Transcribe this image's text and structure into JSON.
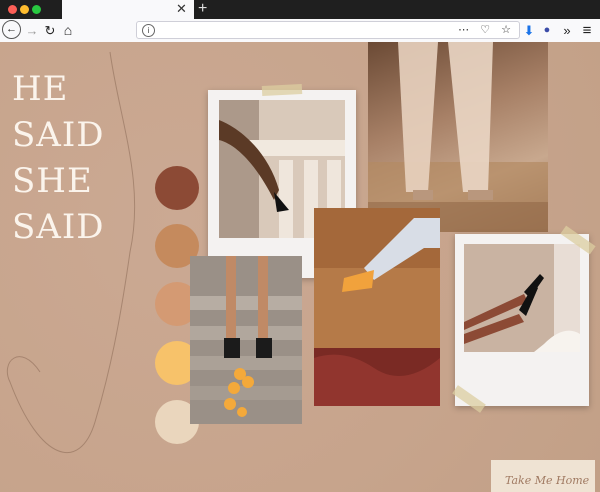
{
  "browser": {
    "window_controls": [
      "close",
      "minimize",
      "maximize"
    ],
    "tab": {
      "title": ""
    },
    "url": "",
    "toolbar_icons": [
      "back-icon",
      "forward-icon",
      "reload-icon",
      "home-icon",
      "more-icon",
      "pocket-icon",
      "bookmark-star-icon",
      "download-icon",
      "account-icon",
      "overflow-icon",
      "menu-icon"
    ]
  },
  "page": {
    "title_lines": [
      "HE",
      "SAID",
      "SHE",
      "SAID"
    ],
    "palette": [
      "#8c4a35",
      "#c58a5d",
      "#d49a73",
      "#f7c26a",
      "#ead6bd"
    ],
    "footer_tag": "Take Me Home"
  },
  "symbols": {
    "close": "✕",
    "new_tab": "+",
    "back": "←",
    "forward": "→",
    "reload": "↻",
    "home": "⌂",
    "info": "i",
    "url_right": "⋯ ♡ ☆",
    "download": "⬇",
    "account": "●",
    "overflow": "»",
    "menu": "≡"
  }
}
